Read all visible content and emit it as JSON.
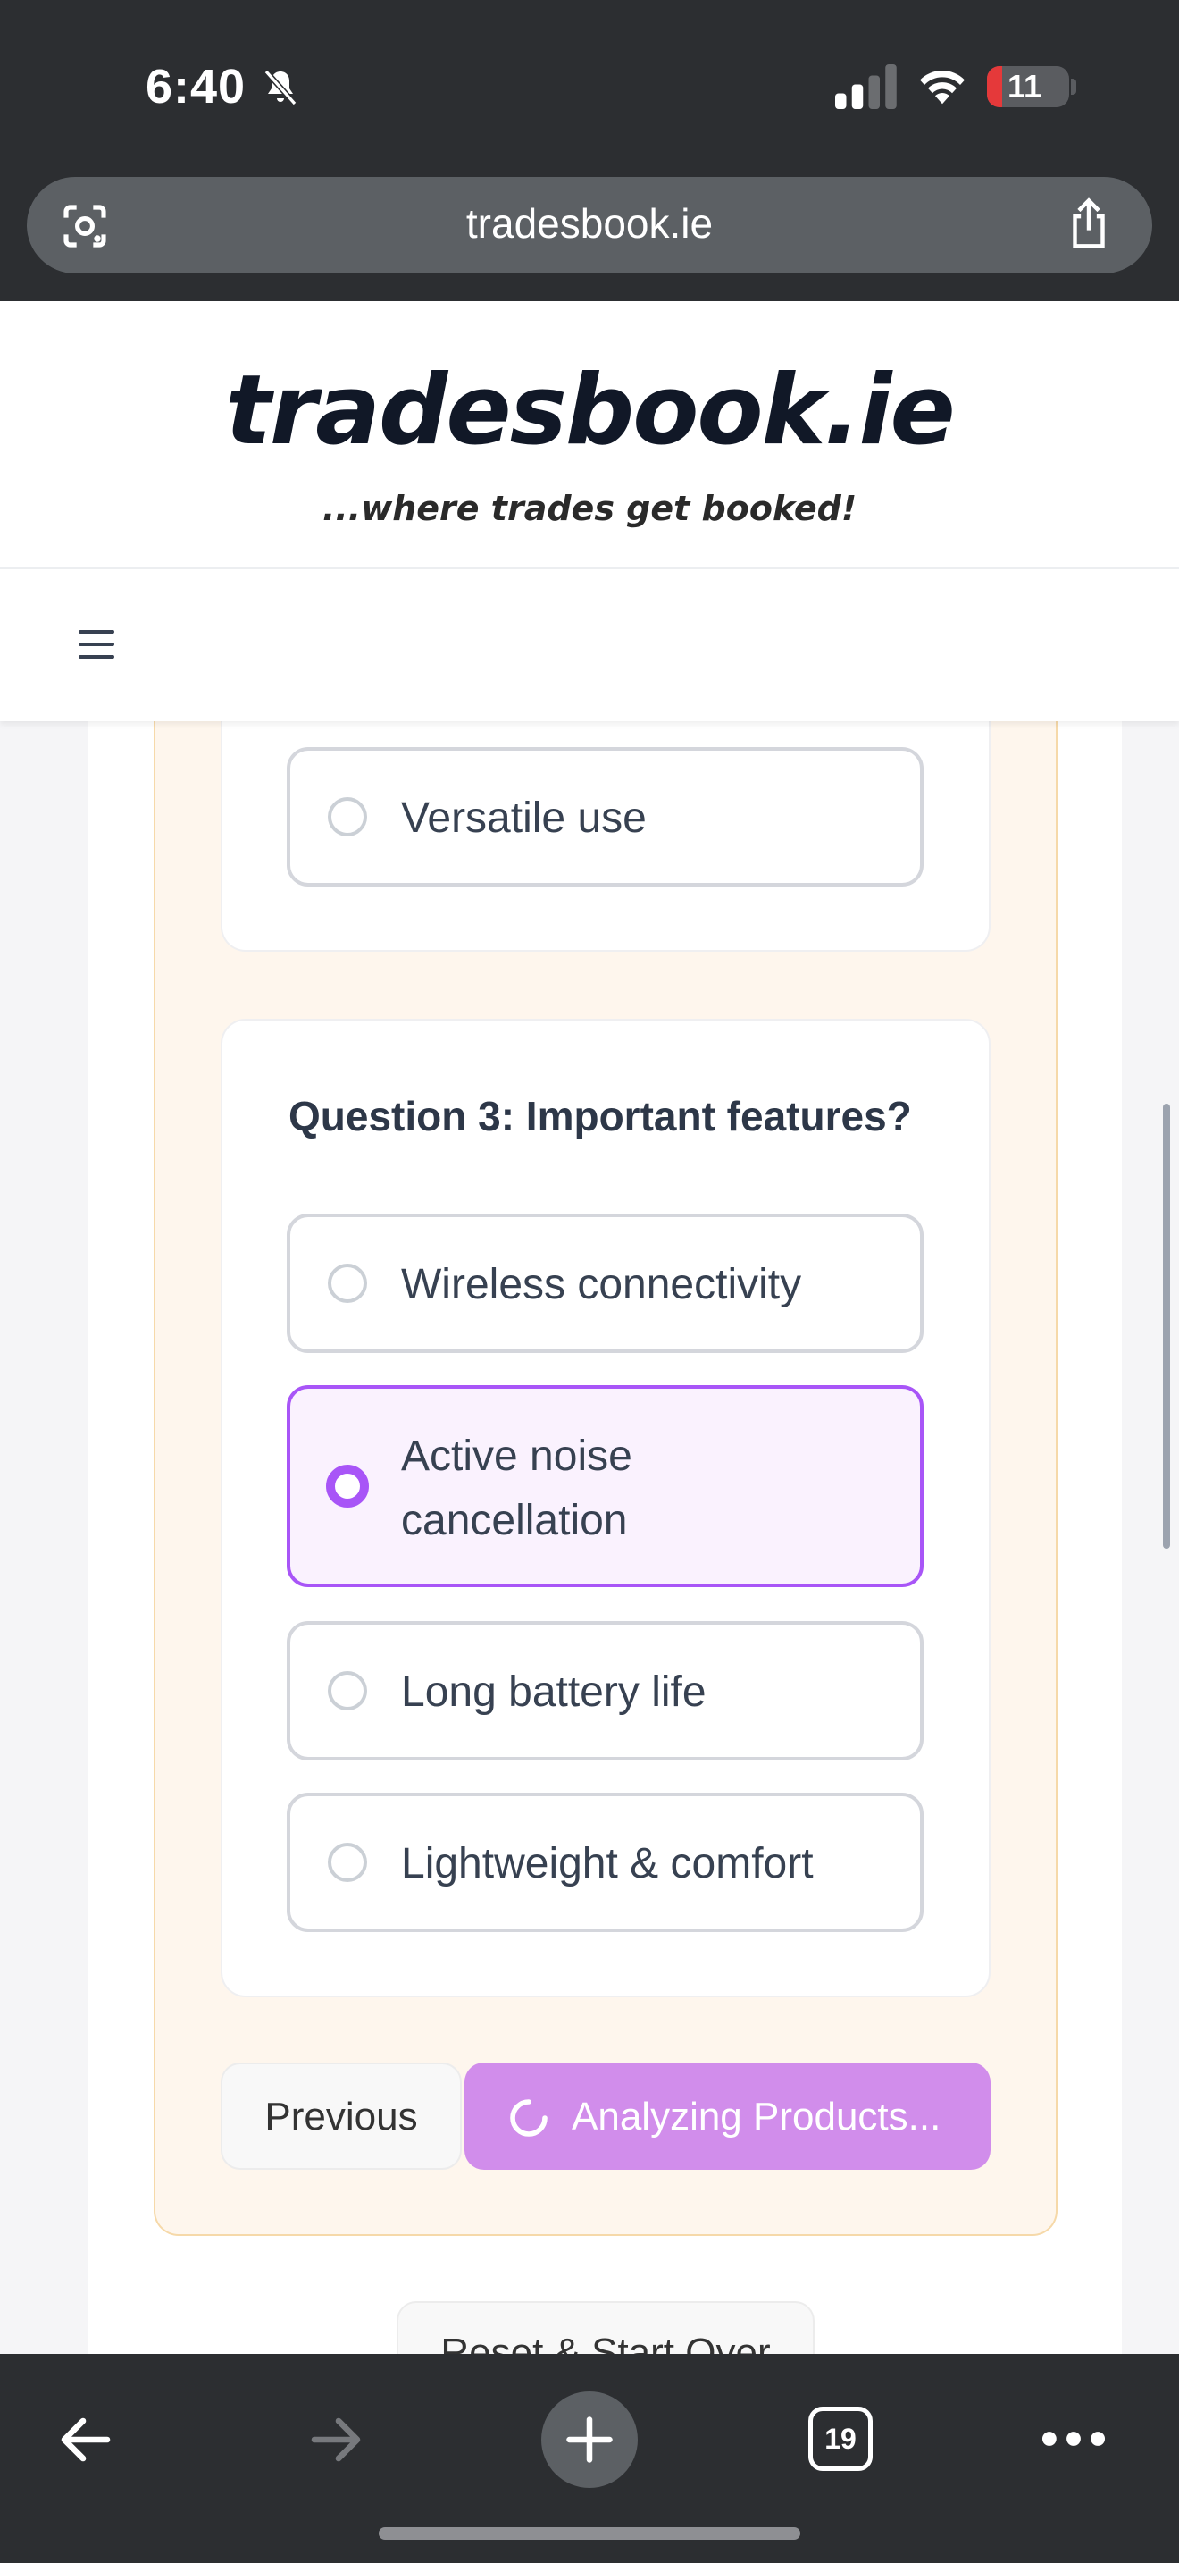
{
  "status_bar": {
    "time": "6:40",
    "battery": "11",
    "battery_level": 0.11
  },
  "browser": {
    "url": "tradesbook.ie",
    "tab_count": "19"
  },
  "site": {
    "logo": "tradesbook.ie",
    "tagline": "...where trades get booked!"
  },
  "quiz": {
    "previous_option": {
      "label": "Versatile use"
    },
    "question3": {
      "title": "Question 3: Important features?",
      "options": [
        {
          "label": "Wireless connectivity",
          "selected": false
        },
        {
          "label": "Active noise cancellation",
          "line1": "Active noise",
          "line2": "cancellation",
          "selected": true
        },
        {
          "label": "Long battery life",
          "selected": false
        },
        {
          "label": "Lightweight & comfort",
          "selected": false
        }
      ]
    },
    "buttons": {
      "previous": "Previous",
      "analyze": "Analyzing Products...",
      "reset": "Reset & Start Over"
    }
  },
  "colors": {
    "accent": "#a855f7",
    "analyze_button": "#d18deb",
    "quiz_bg": "#fef6ed",
    "battery_low": "#e5393a"
  },
  "icons": [
    "bell-slash-icon",
    "signal-icon",
    "wifi-icon",
    "battery-icon",
    "lens-icon",
    "share-icon",
    "hamburger-icon",
    "spinner-icon",
    "back-arrow-icon",
    "forward-arrow-icon",
    "plus-icon",
    "tabs-icon",
    "more-icon"
  ]
}
